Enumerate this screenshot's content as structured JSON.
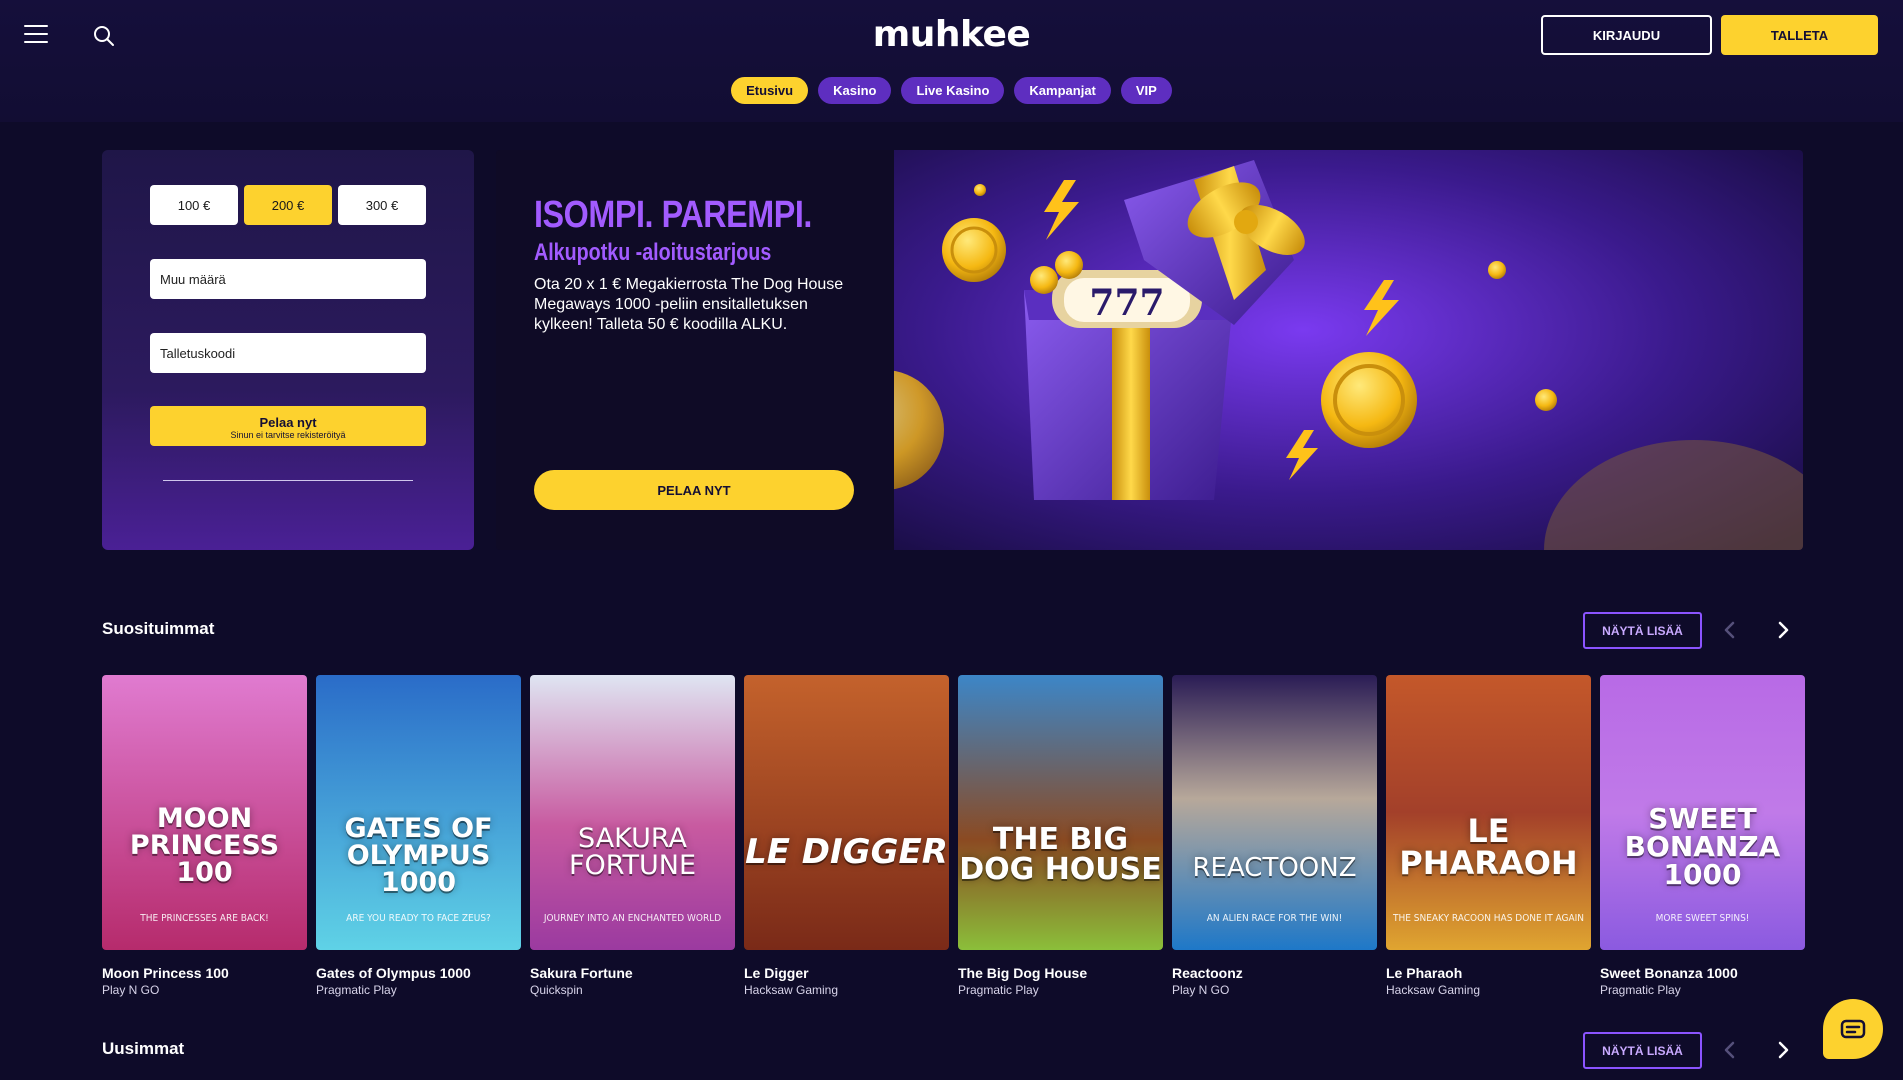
{
  "header": {
    "logo": "muhkee",
    "login_label": "KIRJAUDU",
    "deposit_label": "TALLETA"
  },
  "nav": {
    "items": [
      {
        "label": "Etusivu",
        "active": true
      },
      {
        "label": "Kasino",
        "active": false
      },
      {
        "label": "Live Kasino",
        "active": false
      },
      {
        "label": "Kampanjat",
        "active": false
      },
      {
        "label": "VIP",
        "active": false
      }
    ]
  },
  "deposit": {
    "amounts": [
      "100 €",
      "200 €",
      "300 €"
    ],
    "selected_amount": "200 €",
    "other_amount_placeholder": "Muu määrä",
    "code_placeholder": "Talletuskoodi",
    "play_label": "Pelaa nyt",
    "play_sublabel": "Sinun ei tarvitse rekisteröityä"
  },
  "promo": {
    "title": "ISOMPI. PAREMPI.",
    "subtitle": "Alkupotku -aloitustarjous",
    "body": "Ota 20 x 1 € Megakierrosta The Dog House Megaways 1000 -peliin ensitalletuksen kylkeen! Talleta 50 € koodilla ALKU.",
    "cta_label": "PELAA NYT",
    "art_reel": "777"
  },
  "sections": {
    "popular": {
      "title": "Suosituimmat",
      "show_more": "NÄYTÄ LISÄÄ"
    },
    "newest": {
      "title": "Uusimmat",
      "show_more": "NÄYTÄ LISÄÄ"
    }
  },
  "games": [
    {
      "name": "Moon Princess 100",
      "provider": "Play N GO",
      "art_title": "MOON PRINCESS 100",
      "art_tag": "THE PRINCESSES ARE BACK!",
      "color_top": "#e07bd0",
      "color_bottom": "#b62b6c"
    },
    {
      "name": "Gates of Olympus 1000",
      "provider": "Pragmatic Play",
      "art_title": "GATES OF OLYMPUS 1000",
      "art_tag": "ARE YOU READY TO FACE ZEUS?",
      "color_top": "#2a6cc8",
      "color_bottom": "#5fd2e6"
    },
    {
      "name": "Sakura Fortune",
      "provider": "Quickspin",
      "art_title": "SAKURA FORTUNE",
      "art_tag": "JOURNEY INTO AN ENCHANTED WORLD",
      "color_top": "#dfe5f2",
      "color_bottom": "#9b3aa0"
    },
    {
      "name": "Le Digger",
      "provider": "Hacksaw Gaming",
      "art_title": "LE DIGGER",
      "art_tag": "",
      "color_top": "#c4622c",
      "color_bottom": "#7a2a18"
    },
    {
      "name": "The Big Dog House",
      "provider": "Pragmatic Play",
      "art_title": "THE BIG DOG HOUSE",
      "art_tag": "",
      "color_top": "#3c86c8",
      "color_bottom": "#8bbf3a"
    },
    {
      "name": "Reactoonz",
      "provider": "Play N GO",
      "art_title": "REACTOONZ",
      "art_tag": "AN ALIEN RACE FOR THE WIN!",
      "color_top": "#2a1c55",
      "color_bottom": "#1e78c8"
    },
    {
      "name": "Le Pharaoh",
      "provider": "Hacksaw Gaming",
      "art_title": "LE PHARAOH",
      "art_tag": "THE SNEAKY RACOON HAS DONE IT AGAIN",
      "color_top": "#c4582a",
      "color_bottom": "#e0a530"
    },
    {
      "name": "Sweet Bonanza 1000",
      "provider": "Pragmatic Play",
      "art_title": "SWEET BONANZA 1000",
      "art_tag": "MORE SWEET SPINS!",
      "color_top": "#b86ae6",
      "color_bottom": "#8b5ae0"
    }
  ],
  "colors": {
    "background": "#0e0b29",
    "accent_yellow": "#fdd22e",
    "accent_purple": "#5e2ec0",
    "promo_text_purple": "#a25bff"
  }
}
